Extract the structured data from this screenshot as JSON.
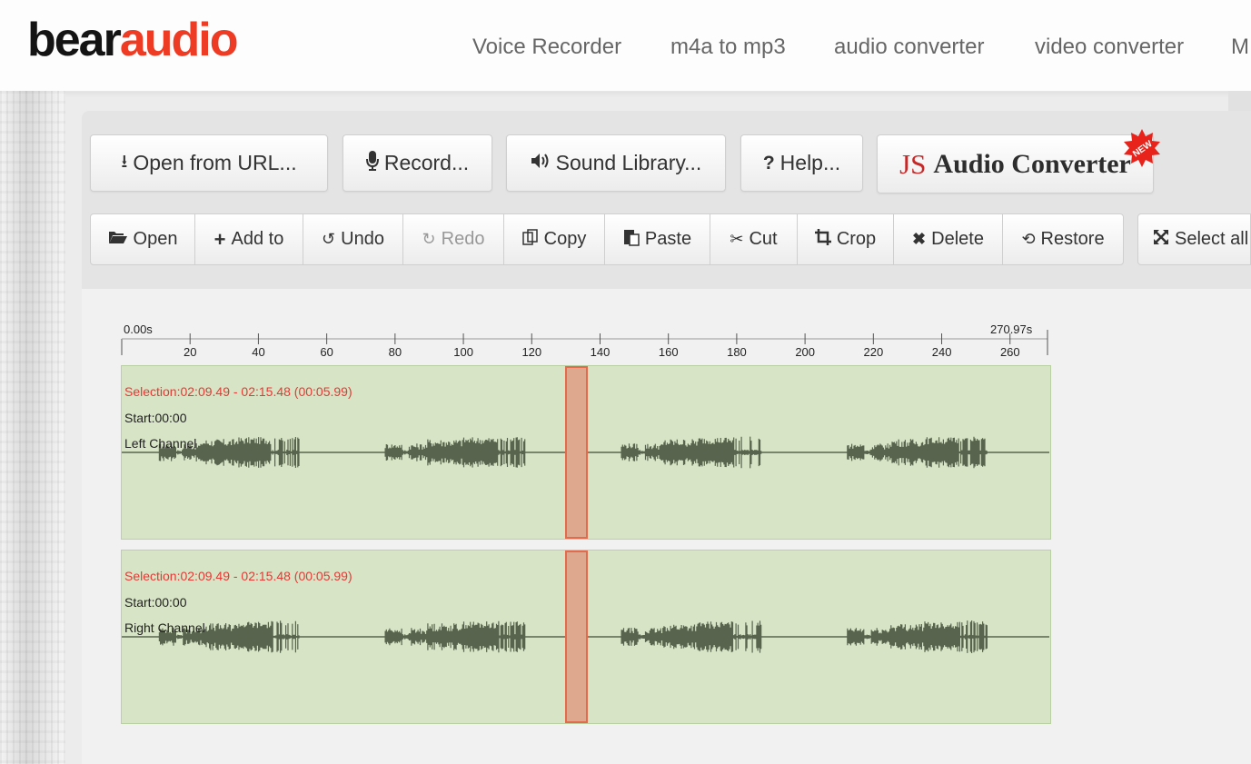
{
  "header": {
    "logo": {
      "part1": "bear",
      "part2": "audio"
    },
    "nav": [
      "Voice Recorder",
      "m4a to mp3",
      "audio converter",
      "video converter",
      "M"
    ]
  },
  "top_buttons": [
    {
      "label": "Open from URL...",
      "icon": "download-icon"
    },
    {
      "label": "Record...",
      "icon": "microphone-icon"
    },
    {
      "label": "Sound Library...",
      "icon": "volume-icon"
    },
    {
      "label": "Help...",
      "icon": "question-icon"
    }
  ],
  "js_converter": {
    "js": "JS",
    "name": "Audio Converter",
    "badge": "NEW"
  },
  "toolbar": [
    {
      "label": "Open",
      "icon": "folder-open-icon",
      "enabled": true
    },
    {
      "label": "Add to",
      "icon": "plus-icon",
      "enabled": true
    },
    {
      "label": "Undo",
      "icon": "undo-icon",
      "enabled": true
    },
    {
      "label": "Redo",
      "icon": "redo-icon",
      "enabled": false
    },
    {
      "label": "Copy",
      "icon": "copy-icon",
      "enabled": true
    },
    {
      "label": "Paste",
      "icon": "paste-icon",
      "enabled": true
    },
    {
      "label": "Cut",
      "icon": "scissors-icon",
      "enabled": true
    },
    {
      "label": "Crop",
      "icon": "crop-icon",
      "enabled": true
    },
    {
      "label": "Delete",
      "icon": "times-icon",
      "enabled": true
    },
    {
      "label": "Restore",
      "icon": "restore-icon",
      "enabled": true
    },
    {
      "label": "Select all",
      "icon": "expand-icon",
      "enabled": true
    }
  ],
  "timeline": {
    "start_label": "0.00s",
    "end_label": "270.97s",
    "duration": 270.97,
    "ticks": [
      20,
      40,
      60,
      80,
      100,
      120,
      140,
      160,
      180,
      200,
      220,
      240,
      260
    ]
  },
  "selection": {
    "start_s": 129.49,
    "end_s": 135.48
  },
  "tracks": [
    {
      "selection_text": "Selection:02:09.49 - 02:15.48 (00:05.99)",
      "start_text": "Start:00:00",
      "channel_label": "Left Channel"
    },
    {
      "selection_text": "Selection:02:09.49 - 02:15.48 (00:05.99)",
      "start_text": "Start:00:00",
      "channel_label": "Right Channel"
    }
  ],
  "waveform_segments_s": [
    [
      11,
      52
    ],
    [
      77,
      118
    ],
    [
      146,
      187
    ],
    [
      212,
      253
    ]
  ],
  "colors": {
    "logo_accent": "#ee3b24",
    "track_bg": "#d7e4c5",
    "waveform": "#59644e",
    "selection_fill": "#dda88d",
    "selection_border": "#e26b4b",
    "selection_text": "#e53935"
  }
}
